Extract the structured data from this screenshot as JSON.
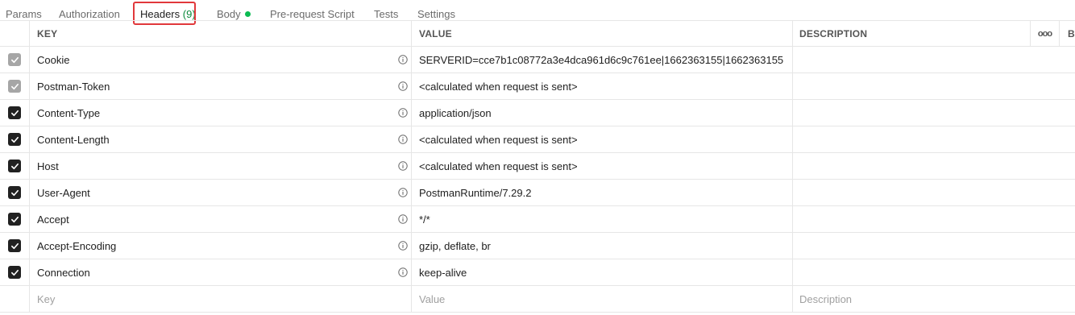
{
  "tabs": [
    {
      "label": "Params"
    },
    {
      "label": "Authorization"
    },
    {
      "label": "Headers",
      "count": "(9)"
    },
    {
      "label": "Body"
    },
    {
      "label": "Pre-request Script"
    },
    {
      "label": "Tests"
    },
    {
      "label": "Settings"
    }
  ],
  "columns": {
    "key": "KEY",
    "value": "VALUE",
    "description": "DESCRIPTION",
    "more": "ooo",
    "bulk": "B"
  },
  "headers": [
    {
      "key": "Cookie",
      "value": "SERVERID=cce7b1c08772a3e4dca961d6c9c761ee|1662363155|1662363155",
      "checked": true,
      "disabled": true
    },
    {
      "key": "Postman-Token",
      "value": "<calculated when request is sent>",
      "checked": true,
      "disabled": true
    },
    {
      "key": "Content-Type",
      "value": "application/json",
      "checked": true,
      "disabled": false
    },
    {
      "key": "Content-Length",
      "value": "<calculated when request is sent>",
      "checked": true,
      "disabled": false
    },
    {
      "key": "Host",
      "value": "<calculated when request is sent>",
      "checked": true,
      "disabled": false
    },
    {
      "key": "User-Agent",
      "value": "PostmanRuntime/7.29.2",
      "checked": true,
      "disabled": false
    },
    {
      "key": "Accept",
      "value": "*/*",
      "checked": true,
      "disabled": false
    },
    {
      "key": "Accept-Encoding",
      "value": "gzip, deflate, br",
      "checked": true,
      "disabled": false
    },
    {
      "key": "Connection",
      "value": "keep-alive",
      "checked": true,
      "disabled": false
    }
  ],
  "new_row": {
    "key_placeholder": "Key",
    "value_placeholder": "Value",
    "description_placeholder": "Description"
  },
  "colors": {
    "highlight": "#e1383b",
    "count": "#0b8a3b",
    "body_dot": "#0cbb52"
  }
}
